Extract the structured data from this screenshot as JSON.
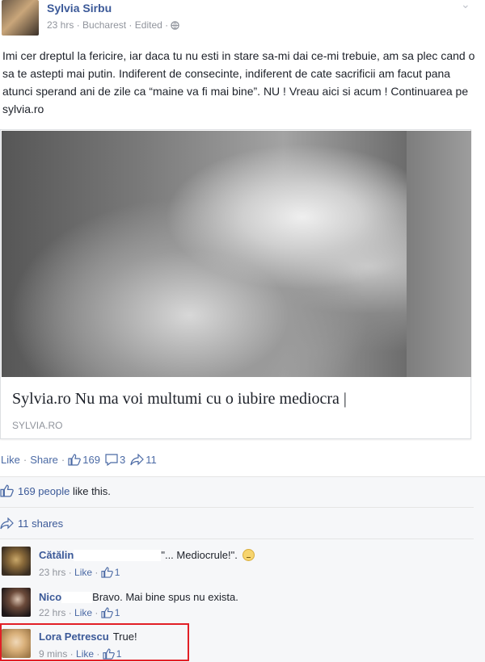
{
  "post": {
    "author": "Sylvia Sirbu",
    "time": "23 hrs",
    "location": "Bucharest",
    "edited": "Edited",
    "text": "Imi cer dreptul la fericire, iar daca tu nu esti in stare sa-mi dai ce-mi trebuie, am sa plec cand o sa te astepti mai putin. Indiferent de consecinte, indiferent de cate sacrificii am facut pana atunci sperand ani de zile ca “maine va fi mai bine”. NU ! Vreau aici si acum ! Continuarea pe sylvia.ro"
  },
  "link": {
    "title": "Sylvia.ro Nu ma voi multumi cu o iubire mediocra |",
    "domain": "SYLVIA.RO"
  },
  "actions": {
    "like": "Like",
    "share": "Share",
    "likes": "169",
    "comments": "3",
    "shares": "11"
  },
  "summary": {
    "likes_count": "169 people",
    "likes_suffix": " like this.",
    "shares": "11 shares"
  },
  "comments": [
    {
      "name": "Cătălin",
      "text": "\"... Mediocrule!\".",
      "time": "23 hrs",
      "like": "Like",
      "likes": "1"
    },
    {
      "name": "Nico",
      "text": "Bravo. Mai bine spus nu exista.",
      "time": "22 hrs",
      "like": "Like",
      "likes": "1"
    },
    {
      "name": "Lora Petrescu",
      "text": "True!",
      "time": "9 mins",
      "like": "Like",
      "likes": "1"
    }
  ],
  "colors": {
    "link": "#3b5998",
    "highlight": "#e21f26"
  }
}
